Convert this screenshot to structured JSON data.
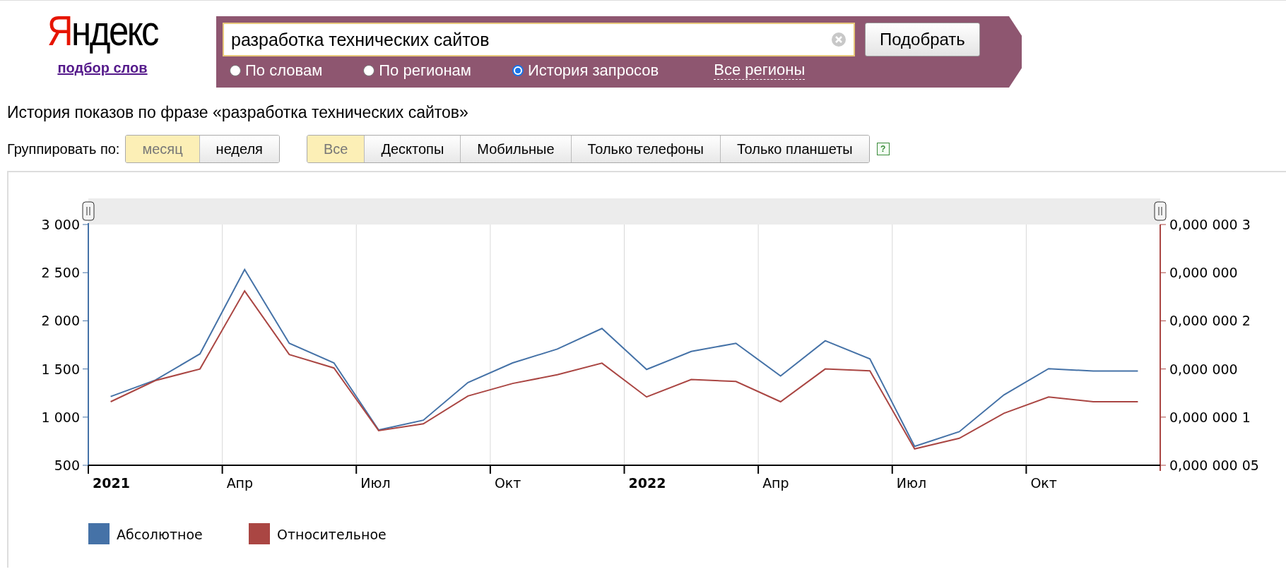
{
  "header": {
    "logo": "Яндекс",
    "service_link": "подбор слов"
  },
  "search": {
    "value": "разработка технических сайтов",
    "submit": "Подобрать",
    "modes": [
      {
        "label": "По словам",
        "selected": false
      },
      {
        "label": "По регионам",
        "selected": false
      },
      {
        "label": "История запросов",
        "selected": true
      }
    ],
    "regions_link": "Все регионы"
  },
  "heading": "История показов по фразе «разработка технических сайтов»",
  "filters": {
    "group_label": "Группировать по:",
    "grouping": [
      {
        "label": "месяц",
        "selected": true
      },
      {
        "label": "неделя",
        "selected": false
      }
    ],
    "devices": [
      {
        "label": "Все",
        "selected": true
      },
      {
        "label": "Десктопы",
        "selected": false
      },
      {
        "label": "Мобильные",
        "selected": false
      },
      {
        "label": "Только телефоны",
        "selected": false
      },
      {
        "label": "Только планшеты",
        "selected": false
      }
    ],
    "help": "?"
  },
  "chart": {
    "chart_data": {
      "type": "line",
      "legend": "bottom",
      "categories": [
        "2021",
        null,
        null,
        "Апр",
        null,
        null,
        "Июл",
        null,
        null,
        "Окт",
        null,
        null,
        "2022",
        null,
        null,
        "Апр",
        null,
        null,
        "Июл",
        null,
        null,
        "Окт",
        null,
        null
      ],
      "ylim": [
        500,
        3000
      ],
      "yticks": [
        {
          "value": 500,
          "label": "500"
        },
        {
          "value": 1000,
          "label": "1 000"
        },
        {
          "value": 1500,
          "label": "1 500"
        },
        {
          "value": 2000,
          "label": "2 000"
        },
        {
          "value": 2500,
          "label": "2 500"
        },
        {
          "value": 3000,
          "label": "3 000"
        }
      ],
      "y2lim": [
        5e-08,
        3e-07
      ],
      "y2ticks": [
        {
          "value": 5e-08,
          "label": "0,000 000 05"
        },
        {
          "value": 1e-07,
          "label": "0,000 000 1"
        },
        {
          "value": 1.5e-07,
          "label": "0,000 000"
        },
        {
          "value": 2e-07,
          "label": "0,000 000 2"
        },
        {
          "value": 2.5e-07,
          "label": "0,000 000"
        },
        {
          "value": 3e-07,
          "label": "0,000 000 3"
        }
      ],
      "series": [
        {
          "name": "Абсолютное",
          "color": "#4572a7",
          "values": [
            1214,
            1384,
            1657,
            2532,
            1767,
            1563,
            866,
            968,
            1359,
            1563,
            1707,
            1920,
            1495,
            1682,
            1767,
            1427,
            1793,
            1605,
            696,
            849,
            1231,
            1503,
            1478,
            1478
          ]
        },
        {
          "name": "Относительное",
          "color": "#aa4643",
          "axis": "y2",
          "values": [
            1.16e-07,
            1.38e-07,
            1.5e-07,
            2.31e-07,
            1.65e-07,
            1.51e-07,
            8.6e-08,
            9.3e-08,
            1.22e-07,
            1.35e-07,
            1.44e-07,
            1.56e-07,
            1.21e-07,
            1.39e-07,
            1.37e-07,
            1.16e-07,
            1.5e-07,
            1.48e-07,
            6.7e-08,
            7.8e-08,
            1.04e-07,
            1.21e-07,
            1.16e-07,
            1.16e-07
          ]
        }
      ]
    }
  }
}
